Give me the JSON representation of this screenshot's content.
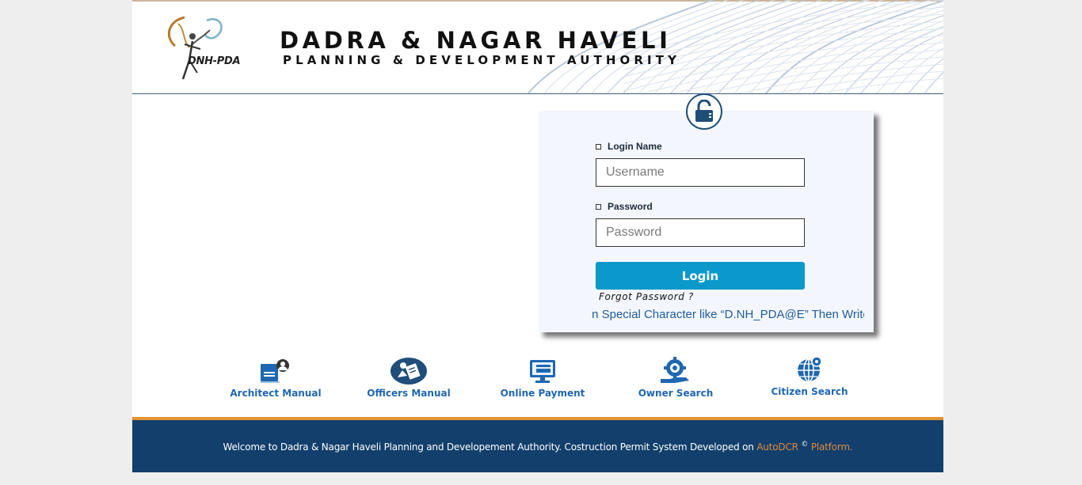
{
  "header": {
    "logo_text": "DNH-PDA",
    "org_name": "DADRA & NAGAR HAVELI",
    "org_subtitle": "PLANNING & DEVELOPMENT AUTHORITY"
  },
  "login": {
    "login_name_label": "Login Name",
    "username_placeholder": "Username",
    "username_value": "",
    "password_label": "Password",
    "password_placeholder": "Password",
    "password_value": "",
    "login_button": "Login",
    "forgot_password": "Forgot Password ?",
    "marquee": "If Your Password Contain Special Character like “D.NH_PDA@E” Then Write"
  },
  "quick_links": [
    {
      "label": "Architect Manual",
      "icon": "architect-manual-icon"
    },
    {
      "label": "Officers Manual",
      "icon": "officers-manual-icon"
    },
    {
      "label": "Online Payment",
      "icon": "online-payment-icon"
    },
    {
      "label": "Owner Search",
      "icon": "owner-search-icon"
    },
    {
      "label": "Citizen Search",
      "icon": "citizen-search-icon"
    }
  ],
  "footer": {
    "text": "Welcome to Dadra & Nagar Haveli Planning and Developement Authority. Costruction Permit System Developed on",
    "brand": "AutoDCR",
    "sup": "©",
    "suffix": "Platform."
  },
  "colors": {
    "footer_bg": "#123f6b",
    "footer_accent": "#e49431",
    "button": "#0b99cc",
    "link": "#1f67b0",
    "panel_bg": "#f3f7fd"
  }
}
